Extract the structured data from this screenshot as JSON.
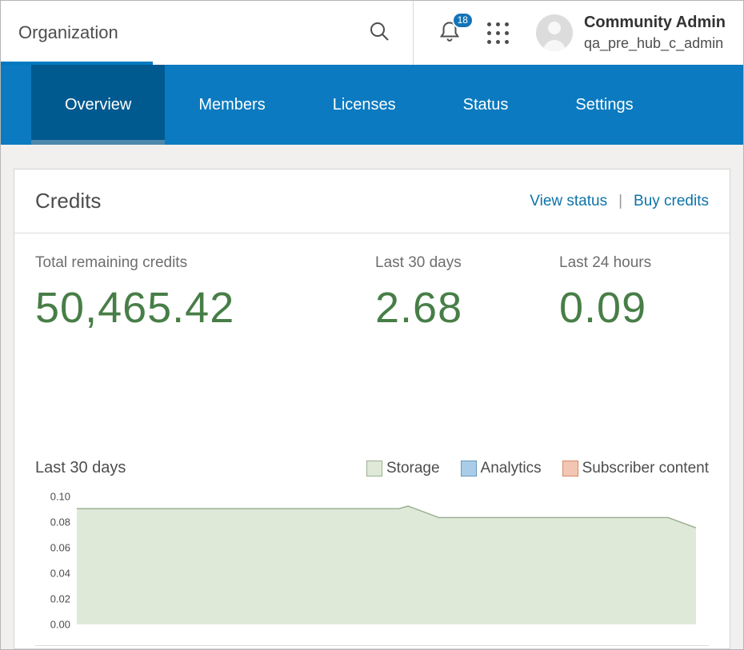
{
  "colors": {
    "brand_blue": "#0b7ac0",
    "active_tab_blue": "#00598f",
    "link_blue": "#0d73a8",
    "credit_green": "#477e47"
  },
  "header": {
    "title": "Organization",
    "notification_count": "18",
    "user": {
      "name": "Community Admin",
      "username": "qa_pre_hub_c_admin"
    }
  },
  "nav": {
    "active_tab": "Overview",
    "tabs": [
      {
        "label": "Overview"
      },
      {
        "label": "Members"
      },
      {
        "label": "Licenses"
      },
      {
        "label": "Status"
      },
      {
        "label": "Settings"
      }
    ]
  },
  "credits": {
    "title": "Credits",
    "view_status_link": "View status",
    "buy_credits_link": "Buy credits",
    "stats": [
      {
        "label": "Total remaining credits",
        "value": "50,465.42"
      },
      {
        "label": "Last 30 days",
        "value": "2.68"
      },
      {
        "label": "Last 24 hours",
        "value": "0.09"
      }
    ],
    "chart_title": "Last 30 days"
  },
  "chart_data": {
    "type": "area",
    "title": "Last 30 days",
    "xlabel": "",
    "ylabel": "",
    "ylim": [
      0,
      0.1
    ],
    "yticks": [
      "0.10",
      "0.08",
      "0.06",
      "0.04",
      "0.02",
      "0.00"
    ],
    "grid": false,
    "legend_position": "top-right",
    "series": [
      {
        "name": "Storage",
        "fill": "#dfe9d8",
        "stroke": "#9cb093",
        "x": [
          0,
          0.52,
          0.535,
          0.585,
          0.955,
          1
        ],
        "values": [
          0.0905,
          0.0905,
          0.0925,
          0.0835,
          0.0835,
          0.0755
        ]
      },
      {
        "name": "Analytics",
        "fill": "#a9cde9",
        "stroke": "#6699bb",
        "x": [
          0,
          1
        ],
        "values": [
          0,
          0
        ]
      },
      {
        "name": "Subscriber content",
        "fill": "#f2c6b3",
        "stroke": "#d48a66",
        "x": [
          0,
          1
        ],
        "values": [
          0,
          0
        ]
      }
    ]
  }
}
